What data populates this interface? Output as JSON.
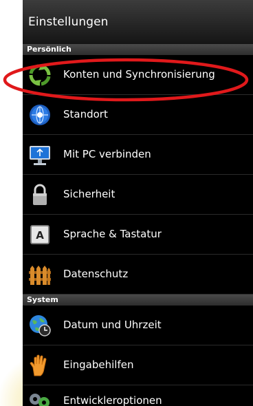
{
  "header": {
    "title": "Einstellungen"
  },
  "sections": [
    {
      "title": "Persönlich",
      "items": [
        {
          "label": "Konten und Synchronisierung",
          "icon": "sync-arrows-icon"
        },
        {
          "label": "Standort",
          "icon": "globe-location-icon"
        },
        {
          "label": "Mit PC verbinden",
          "icon": "usb-monitor-icon"
        },
        {
          "label": "Sicherheit",
          "icon": "padlock-icon"
        },
        {
          "label": "Sprache & Tastatur",
          "icon": "keyboard-key-icon"
        },
        {
          "label": "Datenschutz",
          "icon": "fence-icon"
        }
      ]
    },
    {
      "title": "System",
      "items": [
        {
          "label": "Datum und Uhrzeit",
          "icon": "globe-clock-icon"
        },
        {
          "label": "Eingabehilfen",
          "icon": "hand-icon"
        },
        {
          "label": "Entwickleroptionen",
          "icon": "gears-icon"
        }
      ]
    }
  ],
  "annotation": {
    "color": "#e0191b",
    "shape": "ellipse",
    "target": "Konten und Synchronisierung"
  },
  "colors": {
    "background": "#000000",
    "text": "#ffffff",
    "section_header": "#3a3a3a",
    "sync_green": "#7ac143",
    "lock_grey": "#b0b0b0",
    "fence_orange": "#c77a1e"
  }
}
